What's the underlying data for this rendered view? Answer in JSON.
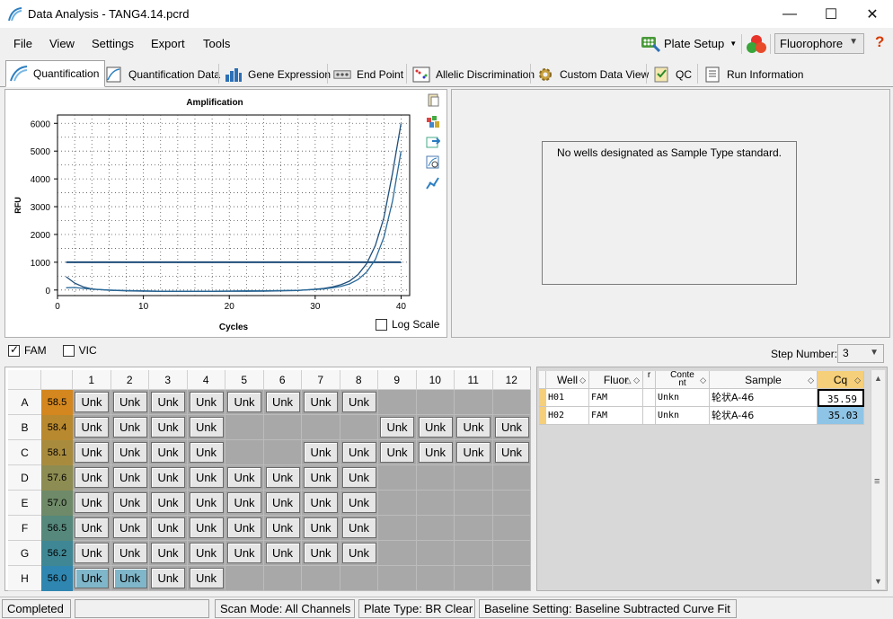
{
  "window": {
    "title": "Data Analysis - TANG4.14.pcrd",
    "minimize": "—",
    "maximize": "☐",
    "close": "✕"
  },
  "menu": {
    "items": [
      "File",
      "View",
      "Settings",
      "Export",
      "Tools"
    ],
    "plate_setup": "Plate Setup",
    "fluorophore": "Fluorophore",
    "help": "?"
  },
  "tabs": [
    {
      "label": "Quantification",
      "active": true
    },
    {
      "label": "Quantification Data"
    },
    {
      "label": "Gene Expression"
    },
    {
      "label": "End Point"
    },
    {
      "label": "Allelic Discrimination"
    },
    {
      "label": "Custom Data View"
    },
    {
      "label": "QC"
    },
    {
      "label": "Run Information"
    }
  ],
  "chart": {
    "log_scale_label": "Log Scale",
    "log_scale_checked": false
  },
  "chart_data": {
    "type": "line",
    "title": "Amplification",
    "xlabel": "Cycles",
    "ylabel": "RFU",
    "xlim": [
      0,
      41
    ],
    "ylim": [
      -200,
      6300
    ],
    "xticks": [
      0,
      10,
      20,
      30,
      40
    ],
    "yticks": [
      0,
      1000,
      2000,
      3000,
      4000,
      5000,
      6000
    ],
    "grid": true,
    "threshold": 1000,
    "threshold_color": "#1f4e79",
    "series": [
      {
        "x": [
          1,
          2,
          3,
          4,
          6,
          8,
          10,
          12,
          14,
          16,
          18,
          20,
          22,
          24,
          26,
          28,
          30,
          31,
          32,
          33,
          34,
          35,
          36,
          37,
          38,
          39,
          40
        ],
        "values": [
          480,
          250,
          110,
          40,
          -10,
          -30,
          -40,
          -50,
          -50,
          -50,
          -50,
          -45,
          -45,
          -40,
          -30,
          -20,
          30,
          60,
          110,
          190,
          320,
          560,
          950,
          1600,
          2600,
          4200,
          6000
        ],
        "color": "#1f4e79"
      },
      {
        "x": [
          1,
          2,
          3,
          4,
          6,
          8,
          10,
          12,
          14,
          16,
          18,
          20,
          22,
          24,
          26,
          28,
          30,
          31,
          32,
          33,
          34,
          35,
          36,
          37,
          38,
          39,
          40
        ],
        "values": [
          80,
          90,
          60,
          30,
          0,
          -20,
          -30,
          -40,
          -40,
          -40,
          -40,
          -35,
          -30,
          -30,
          -20,
          -10,
          20,
          40,
          80,
          130,
          220,
          380,
          650,
          1100,
          1900,
          3200,
          5000
        ],
        "color": "#2a6a9a"
      }
    ]
  },
  "std_curve": {
    "message": "No wells designated as Sample Type standard."
  },
  "fluors": [
    {
      "label": "FAM",
      "checked": true
    },
    {
      "label": "VIC",
      "checked": false
    }
  ],
  "step": {
    "label": "Step Number:",
    "value": "3"
  },
  "plate": {
    "columns": [
      "1",
      "2",
      "3",
      "4",
      "5",
      "6",
      "7",
      "8",
      "9",
      "10",
      "11",
      "12"
    ],
    "rows": [
      {
        "label": "A",
        "temp": "58.5",
        "temp_color": "#d4871f",
        "wells": [
          1,
          1,
          1,
          1,
          1,
          1,
          1,
          1,
          0,
          0,
          0,
          0
        ]
      },
      {
        "label": "B",
        "temp": "58.4",
        "temp_color": "#b9892f",
        "wells": [
          1,
          1,
          1,
          1,
          0,
          0,
          0,
          0,
          1,
          1,
          1,
          1
        ]
      },
      {
        "label": "C",
        "temp": "58.1",
        "temp_color": "#a98b3e",
        "wells": [
          1,
          1,
          1,
          1,
          0,
          0,
          1,
          1,
          1,
          1,
          1,
          1
        ]
      },
      {
        "label": "D",
        "temp": "57.6",
        "temp_color": "#8d8c52",
        "wells": [
          1,
          1,
          1,
          1,
          1,
          1,
          1,
          1,
          0,
          0,
          0,
          0
        ]
      },
      {
        "label": "E",
        "temp": "57.0",
        "temp_color": "#6f8a68",
        "wells": [
          1,
          1,
          1,
          1,
          1,
          1,
          1,
          1,
          0,
          0,
          0,
          0
        ]
      },
      {
        "label": "F",
        "temp": "56.5",
        "temp_color": "#56887c",
        "wells": [
          1,
          1,
          1,
          1,
          1,
          1,
          1,
          1,
          0,
          0,
          0,
          0
        ]
      },
      {
        "label": "G",
        "temp": "56.2",
        "temp_color": "#3f8794",
        "wells": [
          1,
          1,
          1,
          1,
          1,
          1,
          1,
          1,
          0,
          0,
          0,
          0
        ]
      },
      {
        "label": "H",
        "temp": "56.0",
        "temp_color": "#2f86b0",
        "wells": [
          2,
          2,
          1,
          1,
          0,
          0,
          0,
          0,
          0,
          0,
          0,
          0
        ]
      }
    ],
    "well_label": "Unk"
  },
  "table": {
    "headers": [
      "Well",
      "Fluor",
      "r",
      "Content",
      "Sample",
      "Cq"
    ],
    "rows": [
      {
        "well": "H01",
        "fluor": "FAM",
        "content": "Unkn",
        "sample": "轮状A-46",
        "cq": "35.59"
      },
      {
        "well": "H02",
        "fluor": "FAM",
        "content": "Unkn",
        "sample": "轮状A-46",
        "cq": "35.03"
      }
    ]
  },
  "status": {
    "state": "Completed",
    "scan_mode": "Scan Mode: All Channels",
    "plate_type": "Plate Type: BR Clear",
    "baseline": "Baseline Setting: Baseline Subtracted Curve Fit"
  }
}
